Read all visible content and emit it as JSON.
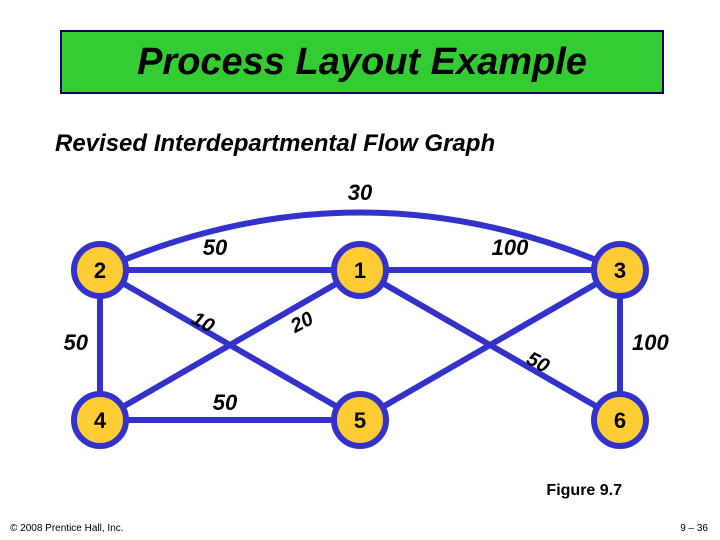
{
  "title": "Process Layout Example",
  "subtitle": "Revised Interdepartmental Flow Graph",
  "nodes": {
    "n1": "1",
    "n2": "2",
    "n3": "3",
    "n4": "4",
    "n5": "5",
    "n6": "6"
  },
  "edge_weights": {
    "e_2_3_top": "30",
    "e_2_1": "50",
    "e_1_3": "100",
    "e_2_4": "50",
    "e_2_5": "10",
    "e_1_4_or_5": "20",
    "e_1_6": "50",
    "e_3_6": "100",
    "e_4_5": "50"
  },
  "figure_caption": "Figure 9.7",
  "copyright": "© 2008 Prentice Hall, Inc.",
  "page_number": "9 – 36"
}
